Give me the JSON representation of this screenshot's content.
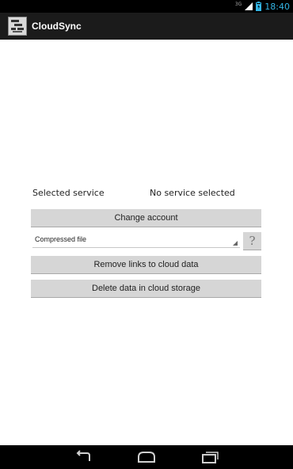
{
  "status_bar": {
    "network": "3G",
    "time": "18:40",
    "icons": [
      "signal-icon",
      "battery-icon"
    ]
  },
  "action_bar": {
    "title": "CloudSync",
    "icon": "app-icon"
  },
  "main": {
    "selected_service_label": "Selected service",
    "selected_service_value": "No service selected",
    "change_account_label": "Change account",
    "format_select_value": "Compressed file",
    "help_label": "?",
    "remove_links_label": "Remove links to cloud data",
    "delete_data_label": "Delete data in cloud storage"
  },
  "nav_bar": {
    "icons": [
      "back-icon",
      "home-icon",
      "recent-apps-icon"
    ]
  },
  "colors": {
    "accent": "#33b5e5",
    "action_bar": "#1b1b1b",
    "button": "#d6d6d6"
  }
}
